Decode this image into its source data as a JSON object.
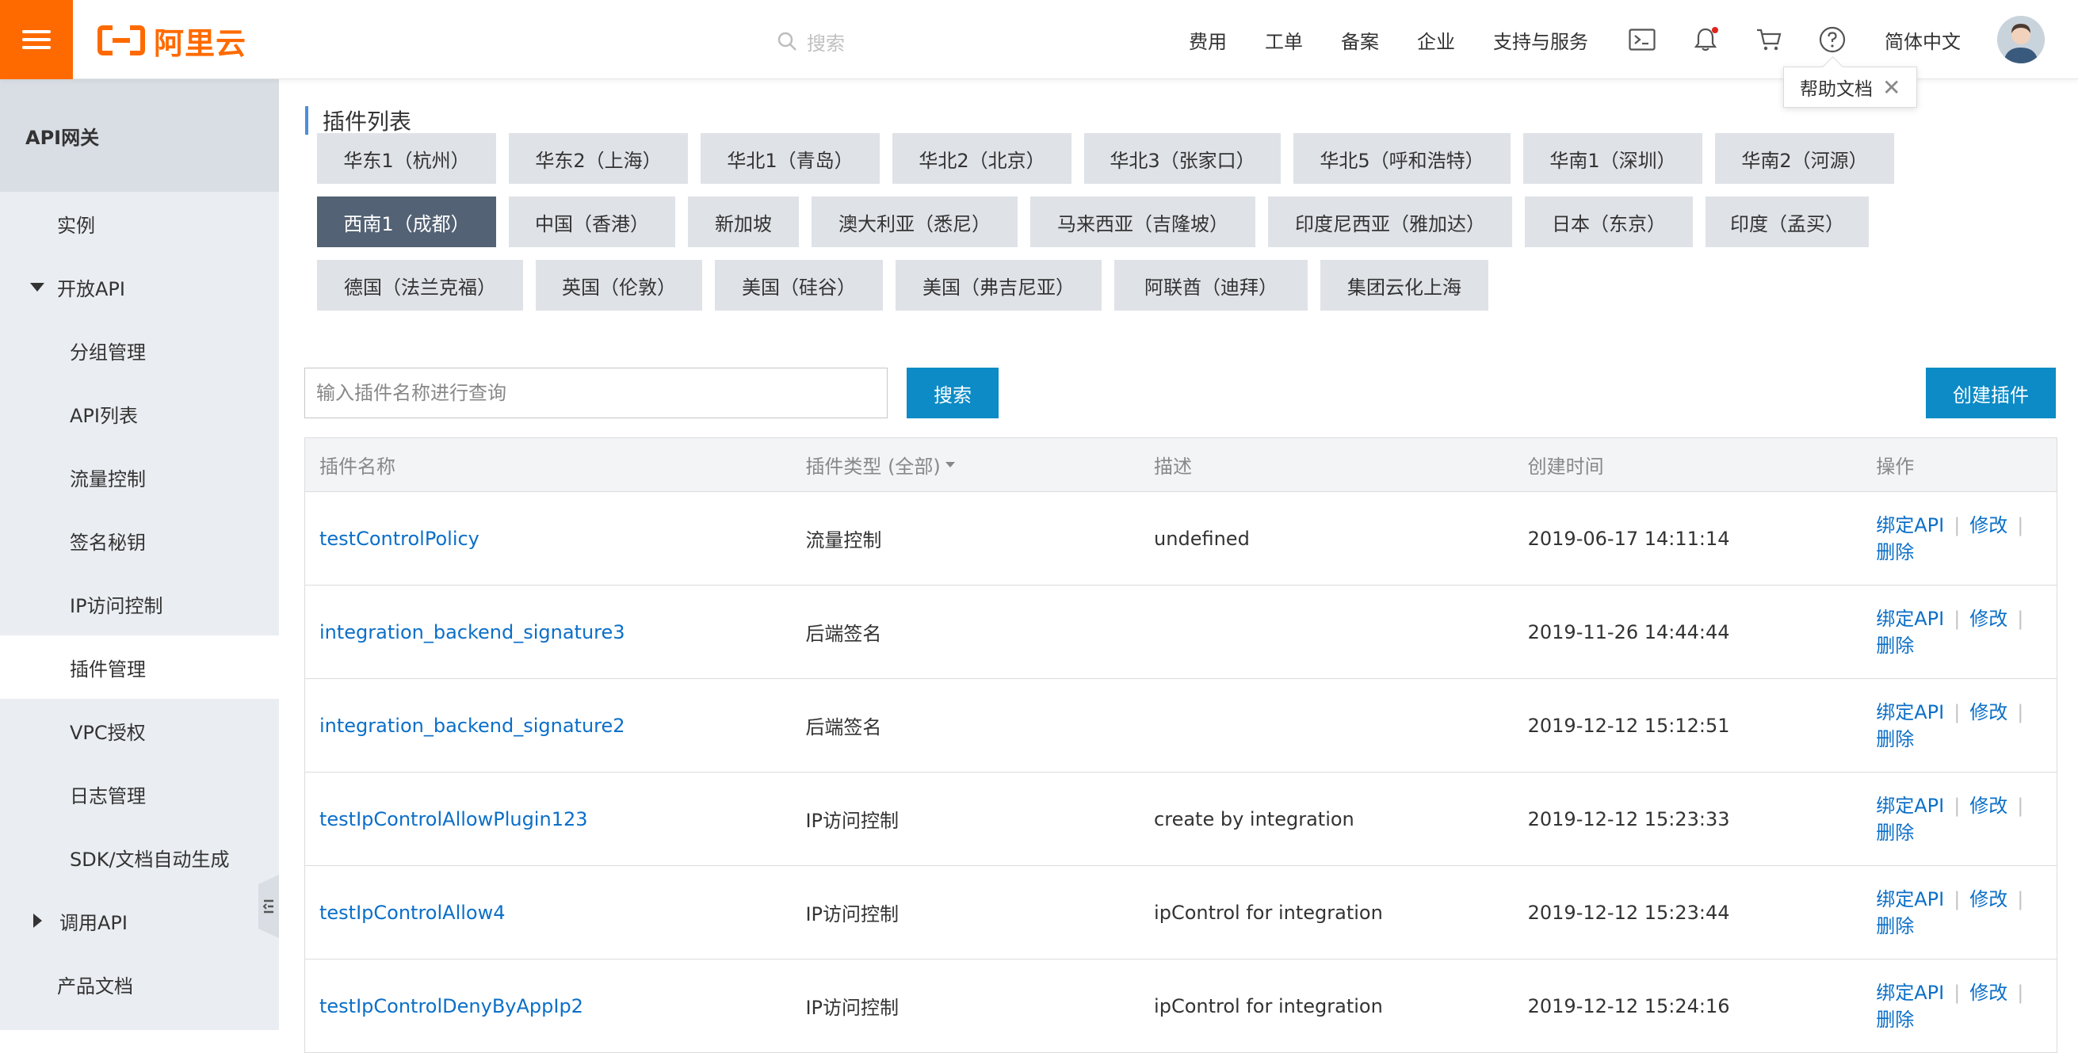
{
  "header": {
    "logo_text": "阿里云",
    "search_placeholder": "搜索",
    "nav": [
      "费用",
      "工单",
      "备案",
      "企业",
      "支持与服务"
    ],
    "language": "简体中文",
    "tooltip_text": "帮助文档",
    "tooltip_close": "✕",
    "brand_color": "#ff6a00",
    "notification_dot_color": "#e1251b"
  },
  "sidebar": {
    "title": "API网关",
    "items": [
      {
        "label": "实例"
      },
      {
        "label": "开放API"
      },
      {
        "label": "分组管理"
      },
      {
        "label": "API列表"
      },
      {
        "label": "流量控制"
      },
      {
        "label": "签名秘钥"
      },
      {
        "label": "IP访问控制"
      },
      {
        "label": "插件管理"
      },
      {
        "label": "VPC授权"
      },
      {
        "label": "日志管理"
      },
      {
        "label": "SDK/文档自动生成"
      },
      {
        "label": "调用API"
      },
      {
        "label": "产品文档"
      }
    ]
  },
  "main": {
    "title": "插件列表",
    "regions_row1": [
      "华东1（杭州）",
      "华东2（上海）",
      "华北1（青岛）",
      "华北2（北京）",
      "华北3（张家口）",
      "华北5（呼和浩特）",
      "华南1（深圳）",
      "华南2（河源）"
    ],
    "regions_row2": [
      "西南1（成都）",
      "中国（香港）",
      "新加坡",
      "澳大利亚（悉尼）",
      "马来西亚（吉隆坡）",
      "印度尼西亚（雅加达）",
      "日本（东京）",
      "印度（孟买）"
    ],
    "regions_row3": [
      "德国（法兰克福）",
      "英国（伦敦）",
      "美国（硅谷）",
      "美国（弗吉尼亚）",
      "阿联酋（迪拜）",
      "集团云化上海"
    ],
    "active_region": "西南1（成都）",
    "filter_placeholder": "输入插件名称进行查询",
    "search_button": "搜索",
    "create_button": "创建插件",
    "accent_color": "#0d8bc6"
  },
  "table": {
    "headers": {
      "name": "插件名称",
      "type": "插件类型 (全部)",
      "desc": "描述",
      "created": "创建时间",
      "ops": "操作"
    },
    "op_labels": {
      "bind": "绑定API",
      "edit": "修改",
      "delete": "删除",
      "sep": "|"
    },
    "rows": [
      {
        "name": "testControlPolicy",
        "type": "流量控制",
        "desc": "undefined",
        "created": "2019-06-17 14:11:14"
      },
      {
        "name": "integration_backend_signature3",
        "type": "后端签名",
        "desc": "",
        "created": "2019-11-26 14:44:44"
      },
      {
        "name": "integration_backend_signature2",
        "type": "后端签名",
        "desc": "",
        "created": "2019-12-12 15:12:51"
      },
      {
        "name": "testIpControlAllowPlugin123",
        "type": "IP访问控制",
        "desc": "create by integration",
        "created": "2019-12-12 15:23:33"
      },
      {
        "name": "testIpControlAllow4",
        "type": "IP访问控制",
        "desc": "ipControl for integration",
        "created": "2019-12-12 15:23:44"
      },
      {
        "name": "testIpControlDenyByAppIp2",
        "type": "IP访问控制",
        "desc": "ipControl for integration",
        "created": "2019-12-12 15:24:16"
      }
    ]
  }
}
